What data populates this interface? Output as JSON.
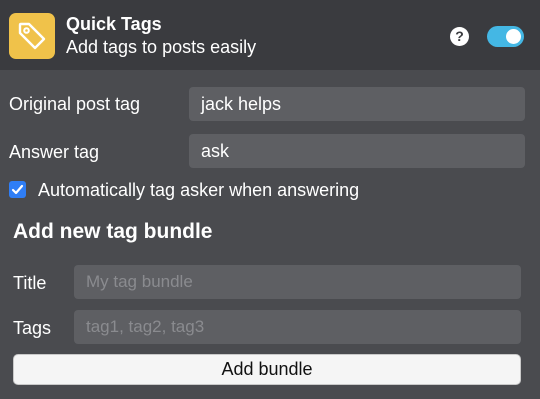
{
  "header": {
    "title": "Quick Tags",
    "subtitle": "Add tags to posts easily",
    "icon": "tag-icon",
    "help_label": "?",
    "toggle_on": true,
    "colors": {
      "icon_bg": "#f0c24a",
      "toggle": "#44b7e4"
    }
  },
  "settings": {
    "original_post_tag": {
      "label": "Original post tag",
      "value": "jack helps"
    },
    "answer_tag": {
      "label": "Answer tag",
      "value": "ask"
    },
    "auto_tag_asker": {
      "label": "Automatically tag asker when answering",
      "checked": true
    }
  },
  "bundle": {
    "heading": "Add new tag bundle",
    "title_label": "Title",
    "title_placeholder": "My tag bundle",
    "tags_label": "Tags",
    "tags_placeholder": "tag1, tag2, tag3",
    "add_label": "Add bundle"
  }
}
